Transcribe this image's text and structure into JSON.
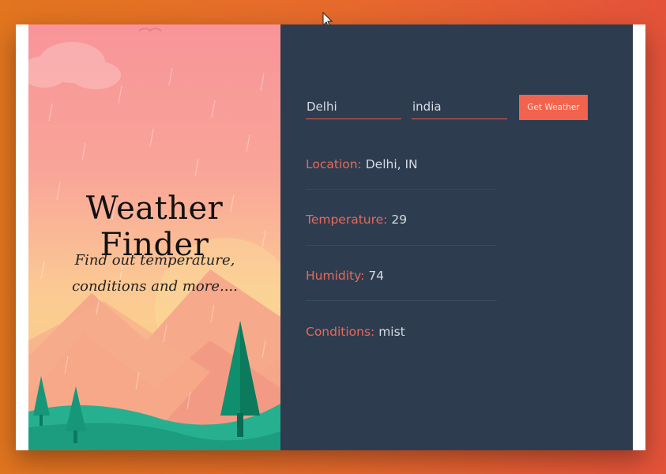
{
  "hero": {
    "title": "Weather Finder",
    "subtitle": "Find out temperature, conditions and more...."
  },
  "form": {
    "city_value": "Delhi",
    "country_value": "india",
    "button_label": "Get Weather"
  },
  "results": {
    "location": {
      "label": "Location:",
      "value": "Delhi, IN"
    },
    "temperature": {
      "label": "Temperature:",
      "value": "29"
    },
    "humidity": {
      "label": "Humidity:",
      "value": "74"
    },
    "conditions": {
      "label": "Conditions:",
      "value": "mist"
    }
  },
  "colors": {
    "accent": "#f1634c",
    "label": "#e66a5b",
    "panel": "#2e3c4f",
    "background": "#e66a2c"
  },
  "icons": [
    "mouse-cursor-icon"
  ]
}
